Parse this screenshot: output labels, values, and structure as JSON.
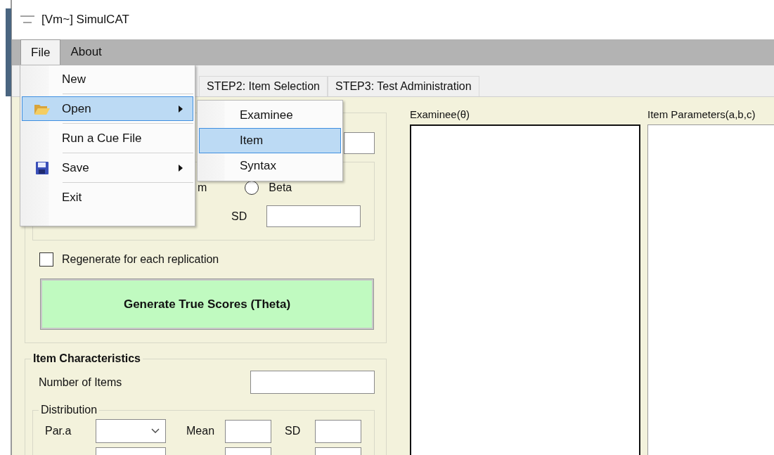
{
  "window": {
    "title": "[Vm~] SimulCAT"
  },
  "menu_bar": [
    {
      "label": "File",
      "selected": true
    },
    {
      "label": "About",
      "selected": false
    }
  ],
  "file_menu": [
    {
      "label": "New",
      "selected": false,
      "has_submenu": false
    },
    {
      "label": "Open",
      "selected": true,
      "has_submenu": true
    },
    {
      "label": "Run a Cue File",
      "selected": false,
      "has_submenu": false
    },
    {
      "label": "Save",
      "selected": false,
      "has_submenu": true
    },
    {
      "label": "Exit",
      "selected": false,
      "has_submenu": false
    }
  ],
  "open_submenu": [
    {
      "label": "Examinee",
      "selected": false
    },
    {
      "label": "Item",
      "selected": true
    },
    {
      "label": "Syntax",
      "selected": false
    }
  ],
  "tabs": [
    {
      "label": "STEP2: Item Selection",
      "selected": false
    },
    {
      "label": "STEP3: Test Administration",
      "selected": false
    }
  ],
  "true_scores": {
    "partial_option": "m",
    "beta_option": {
      "label": "Beta",
      "selected": false
    },
    "sd_label": "SD",
    "regenerate": {
      "label": "Regenerate for each replication",
      "checked": false
    },
    "generate_button": "Generate True Scores (Theta)"
  },
  "item_characteristics": {
    "title": "Item Characteristics",
    "number_label": "Number of Items",
    "distribution_title": "Distribution",
    "parameter_label": "Par.a",
    "mean_label": "Mean",
    "sd_label": "SD"
  },
  "lists": [
    {
      "label": "Examinee(θ)"
    },
    {
      "label": "Item Parameters(a,b,c)"
    }
  ]
}
